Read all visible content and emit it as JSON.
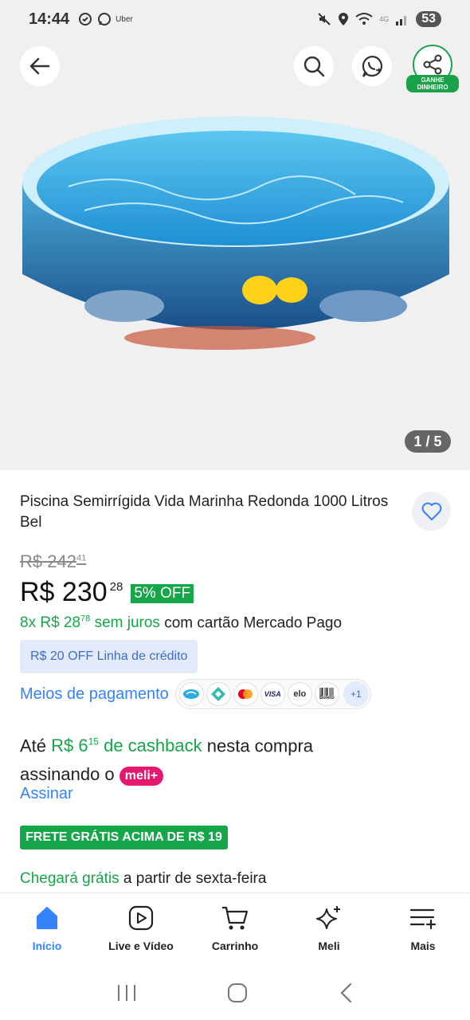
{
  "status_bar": {
    "time": "14:44",
    "left_icons": [
      "sync-icon",
      "whatsapp-icon"
    ],
    "uber_label": "Uber",
    "network": "4G",
    "battery": "53"
  },
  "header": {
    "back_icon": "arrow-left-icon",
    "search_icon": "search-icon",
    "whatsapp_share_icon": "whatsapp-share-icon",
    "share_icon": "share-icon",
    "share_badge_line1": "GANHE",
    "share_badge_line2": "DINHEIRO"
  },
  "gallery": {
    "counter": "1 / 5"
  },
  "product": {
    "title": "Piscina Semirrígida Vida Marinha Redonda 1000 Litros Bel",
    "old_price_currency": "R$",
    "old_price_int": "242",
    "old_price_cents": "41",
    "price_currency": "R$",
    "price_int": "230",
    "price_cents": "28",
    "discount": "5% OFF",
    "installments_prefix": "8x R$ 28",
    "installments_cents": "78",
    "installments_no_interest": "sem juros",
    "installments_suffix": " com cartão Mercado Pago",
    "credit_chip": "R$ 20 OFF Linha de crédito",
    "payment_link": "Meios de pagamento",
    "payment_icons": [
      "mercadopago-icon",
      "pix-icon",
      "mastercard-icon",
      "visa-icon",
      "elo-icon",
      "boleto-icon"
    ],
    "visa_text": "VISA",
    "elo_text": "elo",
    "boleto_text": "Boleto",
    "payment_more": "+1"
  },
  "cashback": {
    "prefix": "Até ",
    "amount": "R$ 6",
    "amount_cents": "15",
    "label": " de cashback",
    "suffix": " nesta compra assinando o ",
    "meli_badge": "meli+",
    "link": "Assinar"
  },
  "shipping": {
    "badge": "FRETE GRÁTIS ACIMA DE R$ 19",
    "delivery_green": "Chegará grátis",
    "delivery_rest": " a partir de sexta-feira"
  },
  "bottom_nav": {
    "items": [
      {
        "label": "Início",
        "icon": "home-icon"
      },
      {
        "label": "Live e Vídeo",
        "icon": "play-icon"
      },
      {
        "label": "Carrinho",
        "icon": "cart-icon"
      },
      {
        "label": "Meli",
        "icon": "sparkle-icon"
      },
      {
        "label": "Mais",
        "icon": "menu-plus-icon"
      }
    ]
  },
  "colors": {
    "accent_blue": "#3483fa",
    "green": "#16a64a",
    "meli_pink": "#e4186f"
  }
}
